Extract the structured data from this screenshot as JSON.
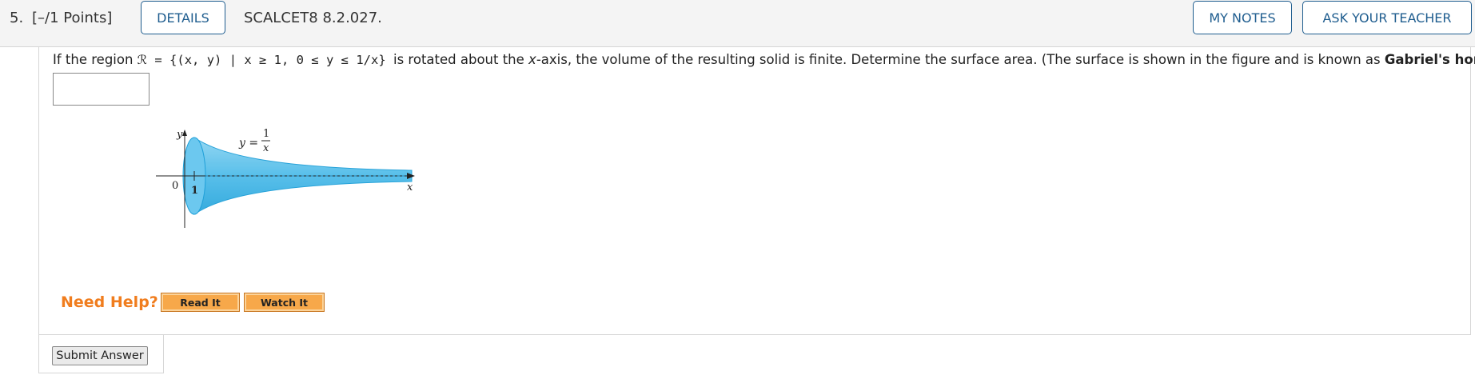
{
  "question": {
    "number": "5.",
    "points": "[–/1 Points]",
    "details_label": "DETAILS",
    "id": "SCALCET8 8.2.027.",
    "my_notes_label": "MY NOTES",
    "ask_teacher_label": "ASK YOUR TEACHER"
  },
  "prompt": {
    "lead": "If the region ",
    "region_symbol": "ℛ",
    "set_text": " = {(x, y) | x ≥ 1, 0 ≤ y ≤ 1/x} ",
    "mid": " is rotated about the ",
    "axis": "x",
    "tail": "-axis, the volume of the resulting solid is finite. Determine the surface area. (The surface is shown in the figure and is known as ",
    "bold": "Gabriel's horn",
    "end": ".)"
  },
  "answer": {
    "value": ""
  },
  "figure": {
    "y_axis_label": "y",
    "x_axis_label": "x",
    "origin_label": "0",
    "tick_label": "1",
    "curve_label_lhs": "y =",
    "curve_label_num": "1",
    "curve_label_den": "x",
    "fill_color": "#5bc0eb",
    "edge_color": "#1e9fd8"
  },
  "help": {
    "title": "Need Help?",
    "read_label": "Read It",
    "watch_label": "Watch It"
  },
  "submit_label": "Submit Answer"
}
